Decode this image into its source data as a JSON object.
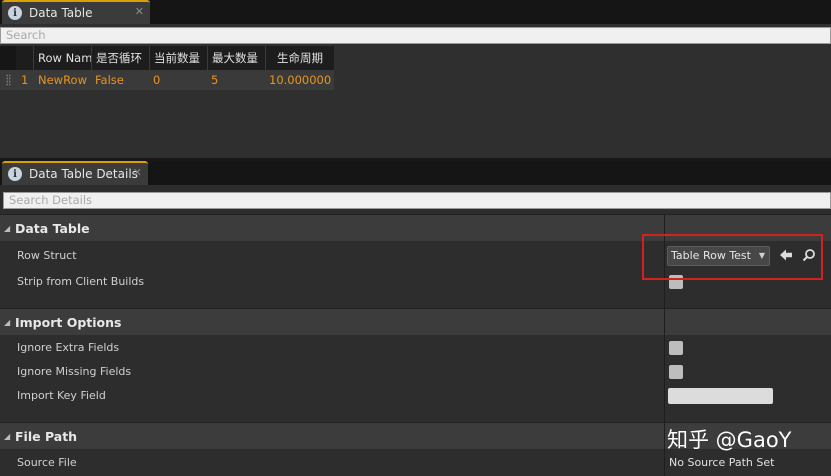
{
  "top_tab": {
    "title": "Data Table",
    "close": "✕"
  },
  "table_search": {
    "placeholder": "Search"
  },
  "table": {
    "columns": [
      "Row Nam",
      "是否循环",
      "当前数量",
      "最大数量",
      "生命周期"
    ],
    "rows": [
      {
        "index": "1",
        "cells": [
          "NewRow",
          "False",
          "0",
          "5",
          "10.000000"
        ]
      }
    ]
  },
  "details_tab": {
    "title": "Data Table Details",
    "close": "✕"
  },
  "details_search": {
    "placeholder": "Search Details"
  },
  "categories": {
    "data_table": {
      "title": "Data Table",
      "row_struct": {
        "label": "Row Struct",
        "value": "Table Row Test"
      },
      "strip_from_client": {
        "label": "Strip from Client Builds"
      }
    },
    "import_options": {
      "title": "Import Options",
      "ignore_extra": {
        "label": "Ignore Extra Fields"
      },
      "ignore_missing": {
        "label": "Ignore Missing Fields"
      },
      "import_key": {
        "label": "Import Key Field"
      }
    },
    "file_path": {
      "title": "File Path",
      "source_file": {
        "label": "Source File",
        "value": "No Source Path Set"
      }
    }
  },
  "watermark": "知乎 @GaoY",
  "icons": {
    "tab": "info-icon",
    "collapse": "collapse-arrow-icon",
    "browse_back": "arrow-left-icon",
    "find": "search-icon"
  },
  "colors": {
    "accent_tab": "#d8a000",
    "row_text": "#e8941d",
    "highlight_box": "#d12222"
  }
}
